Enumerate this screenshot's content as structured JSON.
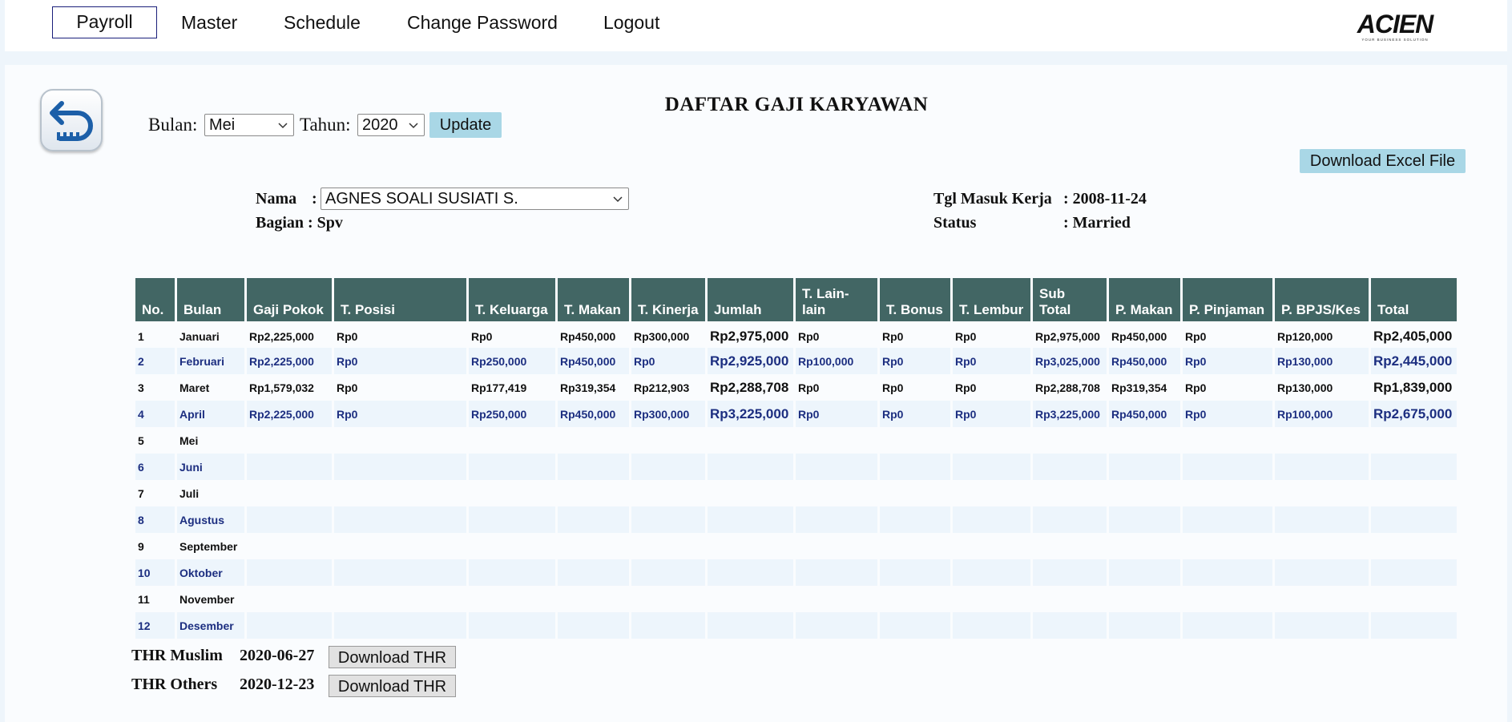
{
  "nav": {
    "items": [
      "Payroll",
      "Master",
      "Schedule",
      "Change Password",
      "Logout"
    ],
    "active": "Payroll",
    "logo_text": "ACIEN",
    "logo_tagline": "YOUR BUSINESS SOLUTION"
  },
  "filter": {
    "month_label": "Bulan:",
    "month_value": "Mei",
    "year_label": "Tahun:",
    "year_value": "2020",
    "update_label": "Update"
  },
  "page_title": "DAFTAR GAJI KARYAWAN",
  "download_excel_label": "Download Excel File",
  "employee": {
    "name_label": "Nama",
    "name_sep": ":",
    "name_value": "AGNES SOALI SUSIATI S.",
    "dept_label": "Bagian : Spv",
    "start_label": "Tgl Masuk Kerja",
    "start_value": ": 2008-11-24",
    "status_label": "Status",
    "status_value": ": Married"
  },
  "table": {
    "headers": [
      "No.",
      "Bulan",
      "Gaji Pokok",
      "T. Posisi",
      "T. Keluarga",
      "T. Makan",
      "T. Kinerja",
      "Jumlah",
      "T. Lain-lain",
      "T. Bonus",
      "T. Lembur",
      "Sub Total",
      "P. Makan",
      "P. Pinjaman",
      "P. BPJS/Kes",
      "Total"
    ],
    "rows": [
      [
        "1",
        "Januari",
        "Rp2,225,000",
        "Rp0",
        "Rp0",
        "Rp450,000",
        "Rp300,000",
        "Rp2,975,000",
        "Rp0",
        "Rp0",
        "Rp0",
        "Rp2,975,000",
        "Rp450,000",
        "Rp0",
        "Rp120,000",
        "Rp2,405,000"
      ],
      [
        "2",
        "Februari",
        "Rp2,225,000",
        "Rp0",
        "Rp250,000",
        "Rp450,000",
        "Rp0",
        "Rp2,925,000",
        "Rp100,000",
        "Rp0",
        "Rp0",
        "Rp3,025,000",
        "Rp450,000",
        "Rp0",
        "Rp130,000",
        "Rp2,445,000"
      ],
      [
        "3",
        "Maret",
        "Rp1,579,032",
        "Rp0",
        "Rp177,419",
        "Rp319,354",
        "Rp212,903",
        "Rp2,288,708",
        "Rp0",
        "Rp0",
        "Rp0",
        "Rp2,288,708",
        "Rp319,354",
        "Rp0",
        "Rp130,000",
        "Rp1,839,000"
      ],
      [
        "4",
        "April",
        "Rp2,225,000",
        "Rp0",
        "Rp250,000",
        "Rp450,000",
        "Rp300,000",
        "Rp3,225,000",
        "Rp0",
        "Rp0",
        "Rp0",
        "Rp3,225,000",
        "Rp450,000",
        "Rp0",
        "Rp100,000",
        "Rp2,675,000"
      ],
      [
        "5",
        "Mei",
        "",
        "",
        "",
        "",
        "",
        "",
        "",
        "",
        "",
        "",
        "",
        "",
        "",
        ""
      ],
      [
        "6",
        "Juni",
        "",
        "",
        "",
        "",
        "",
        "",
        "",
        "",
        "",
        "",
        "",
        "",
        "",
        ""
      ],
      [
        "7",
        "Juli",
        "",
        "",
        "",
        "",
        "",
        "",
        "",
        "",
        "",
        "",
        "",
        "",
        "",
        ""
      ],
      [
        "8",
        "Agustus",
        "",
        "",
        "",
        "",
        "",
        "",
        "",
        "",
        "",
        "",
        "",
        "",
        "",
        ""
      ],
      [
        "9",
        "September",
        "",
        "",
        "",
        "",
        "",
        "",
        "",
        "",
        "",
        "",
        "",
        "",
        "",
        ""
      ],
      [
        "10",
        "Oktober",
        "",
        "",
        "",
        "",
        "",
        "",
        "",
        "",
        "",
        "",
        "",
        "",
        "",
        ""
      ],
      [
        "11",
        "November",
        "",
        "",
        "",
        "",
        "",
        "",
        "",
        "",
        "",
        "",
        "",
        "",
        "",
        ""
      ],
      [
        "12",
        "Desember",
        "",
        "",
        "",
        "",
        "",
        "",
        "",
        "",
        "",
        "",
        "",
        "",
        "",
        ""
      ]
    ]
  },
  "thr": [
    {
      "label": "THR Muslim",
      "date": "2020-06-27",
      "button": "Download THR"
    },
    {
      "label": "THR Others",
      "date": "2020-12-23",
      "button": "Download THR"
    }
  ],
  "colors": {
    "header_bg": "#426664",
    "even_row_text": "#1c2e80",
    "button_blue": "#a9d7e6"
  },
  "icons": [
    "back-arrow-icon",
    "chevron-down-icon"
  ]
}
